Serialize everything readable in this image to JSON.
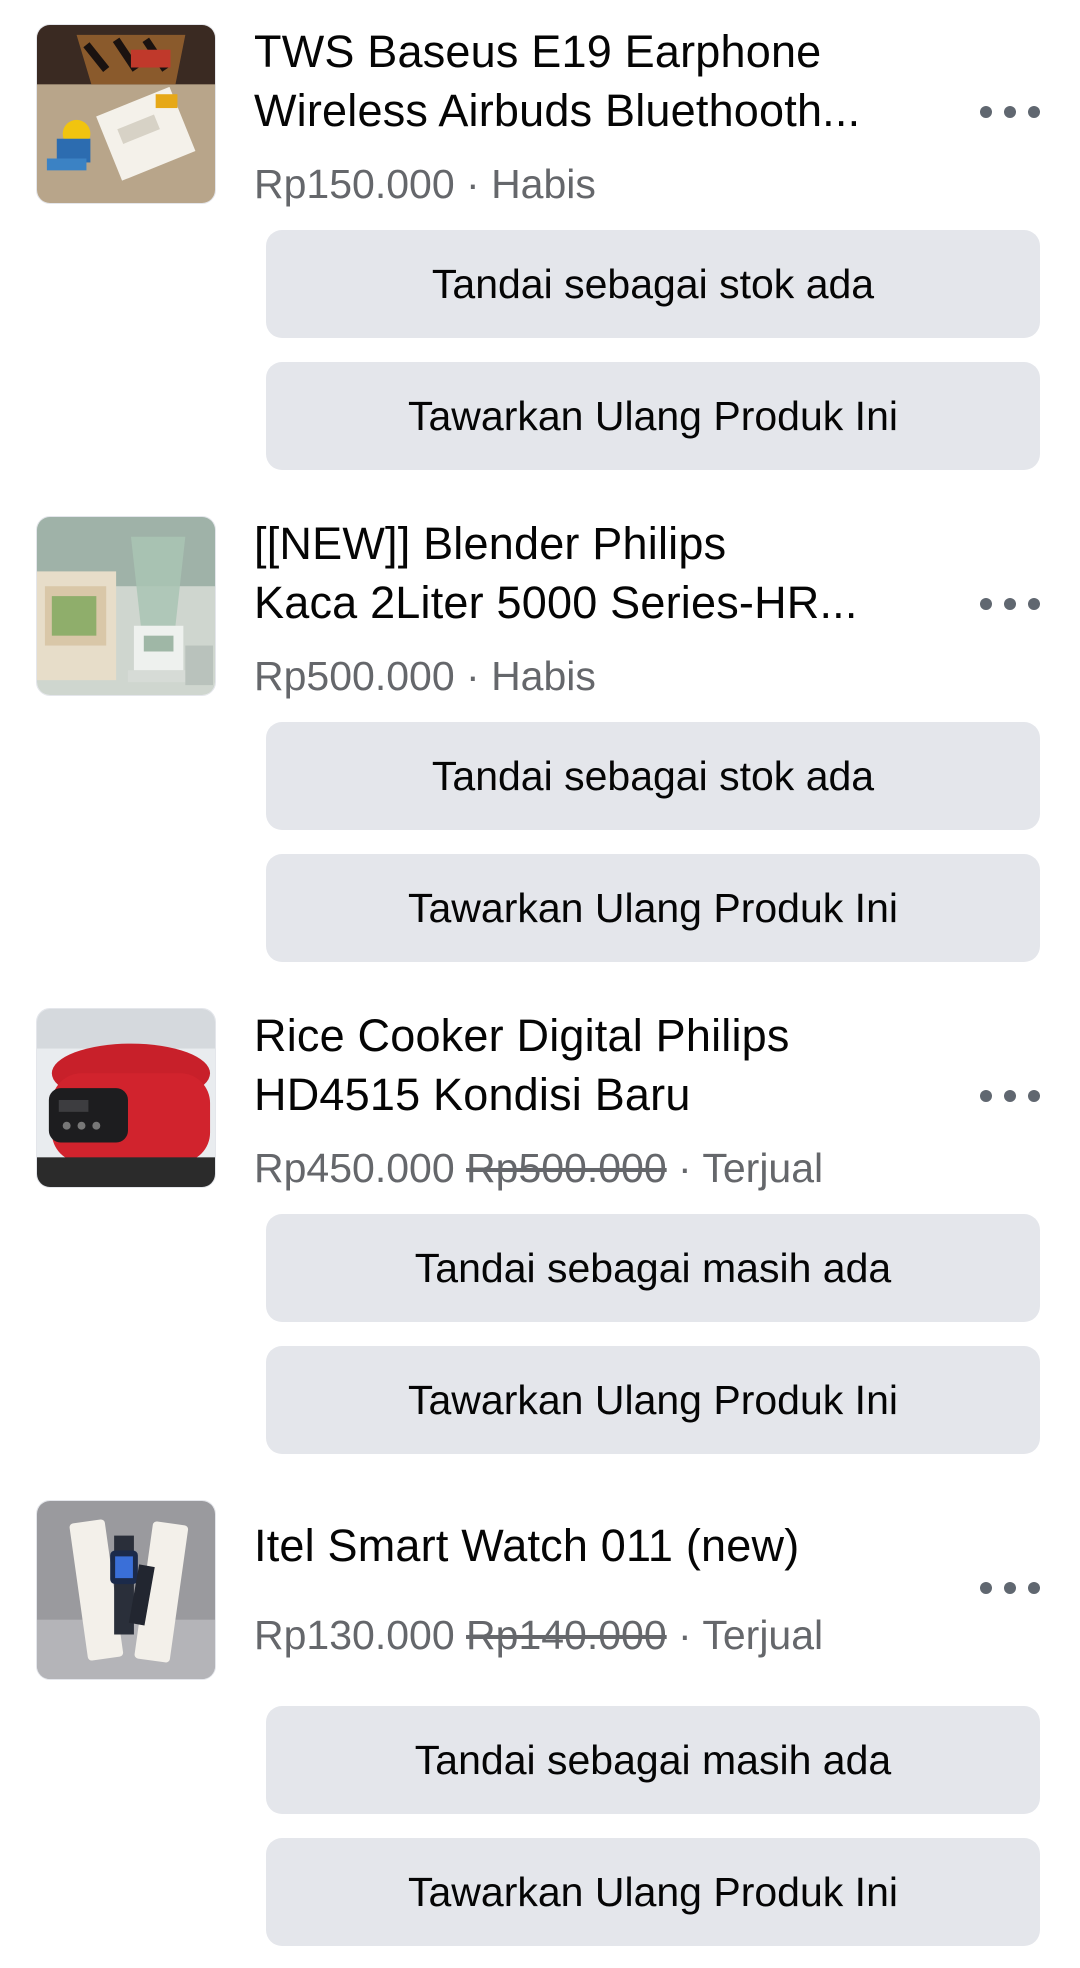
{
  "listings": [
    {
      "title_line1": "TWS Baseus E19 Earphone",
      "title_line2": "Wireless Airbuds Bluethooth...",
      "price": "Rp150.000",
      "old_price": "",
      "separator": " · ",
      "status": "Habis",
      "primary_action": "Tandai sebagai stok ada",
      "secondary_action": "Tawarkan Ulang Produk Ini",
      "thumbnail_icon": "earphone-product-photo"
    },
    {
      "title_line1": "[[NEW]] Blender Philips",
      "title_line2": "Kaca 2Liter 5000 Series-HR...",
      "price": "Rp500.000",
      "old_price": "",
      "separator": " · ",
      "status": "Habis",
      "primary_action": "Tandai sebagai stok ada",
      "secondary_action": "Tawarkan Ulang Produk Ini",
      "thumbnail_icon": "blender-product-photo"
    },
    {
      "title_line1": "Rice Cooker Digital Philips",
      "title_line2": "HD4515 Kondisi Baru",
      "price": "Rp450.000",
      "old_price": "Rp500.000",
      "separator": " · ",
      "status": "Terjual",
      "primary_action": "Tandai sebagai masih ada",
      "secondary_action": "Tawarkan Ulang Produk Ini",
      "thumbnail_icon": "rice-cooker-product-photo"
    },
    {
      "title_line1": "Itel Smart Watch 011 (new)",
      "title_line2": "",
      "price": "Rp130.000",
      "old_price": "Rp140.000",
      "separator": " · ",
      "status": "Terjual",
      "primary_action": "Tandai sebagai masih ada",
      "secondary_action": "Tawarkan Ulang Produk Ini",
      "thumbnail_icon": "smart-watch-product-photo"
    }
  ],
  "colors": {
    "button_bg": "#e4e6eb",
    "secondary_text": "#65676b",
    "primary_text": "#050505"
  }
}
